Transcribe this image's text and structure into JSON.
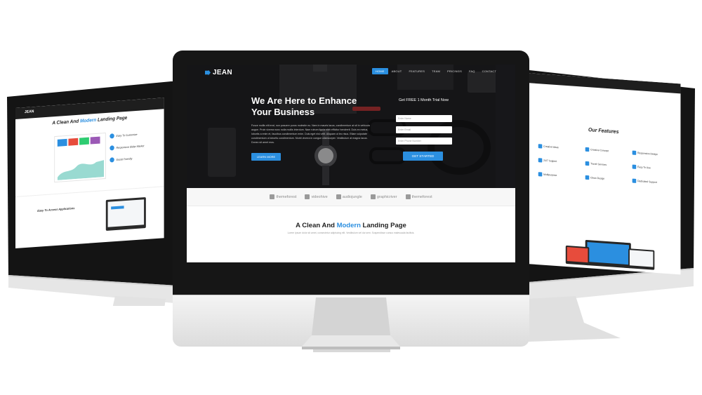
{
  "brand": {
    "name": "JEAN",
    "accent": "#2b8fe0"
  },
  "nav": {
    "items": [
      {
        "label": "HOME",
        "active": true
      },
      {
        "label": "ABOUT",
        "active": false
      },
      {
        "label": "FEATURES",
        "active": false
      },
      {
        "label": "TEAM",
        "active": false
      },
      {
        "label": "PRICINGS",
        "active": false
      },
      {
        "label": "FAQ",
        "active": false
      },
      {
        "label": "CONTACT",
        "active": false
      }
    ]
  },
  "hero": {
    "title": "We Are Here to Enhance Your Business",
    "text": "Fusce mollis elit erat, non posuere purus molestie eu. Nam in mauris lacus, condimentum at sit in vehicula augue. Proin viverra nunc nulla mollis interdum. Nam rutrum ligula nibh efficitur hendrerit. Duis ex metus, lobortis a enim et, faucibus condimentum enim. Duis eget nisl velit. Aliquam ut leo risus. Etiam vulputate condimentum ut lobortis condimentum. Morbi viverra in congue ullamcorper. Vestibulum at magna lacus. Donec sit amet eros.",
    "button": "LEARN MORE"
  },
  "form": {
    "title": "Get FREE 1 Month Trial Now",
    "fields": [
      {
        "placeholder": "Enter Name"
      },
      {
        "placeholder": "Enter Email"
      },
      {
        "placeholder": "Enter Phone Number"
      }
    ],
    "submit": "GET STARTED"
  },
  "partners": [
    "themeforest",
    "videohive",
    "audiojungle",
    "graphicriver",
    "themeforest"
  ],
  "section": {
    "title_pre": "A Clean And ",
    "title_hl": "Modern",
    "title_post": " Landing Page",
    "subtitle": "Lorem ipsum dolor sit amet, consectetur adipiscing elit. Vestibulum vel dui sem. Suspendisse cursus malesuada facilisis."
  },
  "left_screen": {
    "brand": "JEAN",
    "title_pre": "A Clean And ",
    "title_hl": "Modern",
    "title_post": " Landing Page",
    "features": [
      "Easy To Customize",
      "Responsive Slider Market",
      "Social Friendly"
    ],
    "section2": "Easy To Access Applications"
  },
  "right_screen": {
    "title": "Our Features",
    "features": [
      "Creative Ideas",
      "Creative Concept",
      "Responsive Design",
      "24/7 Support",
      "Travel Services",
      "Easy To Use",
      "Multipurpose",
      "Clean Design",
      "Dedicated Support"
    ]
  }
}
